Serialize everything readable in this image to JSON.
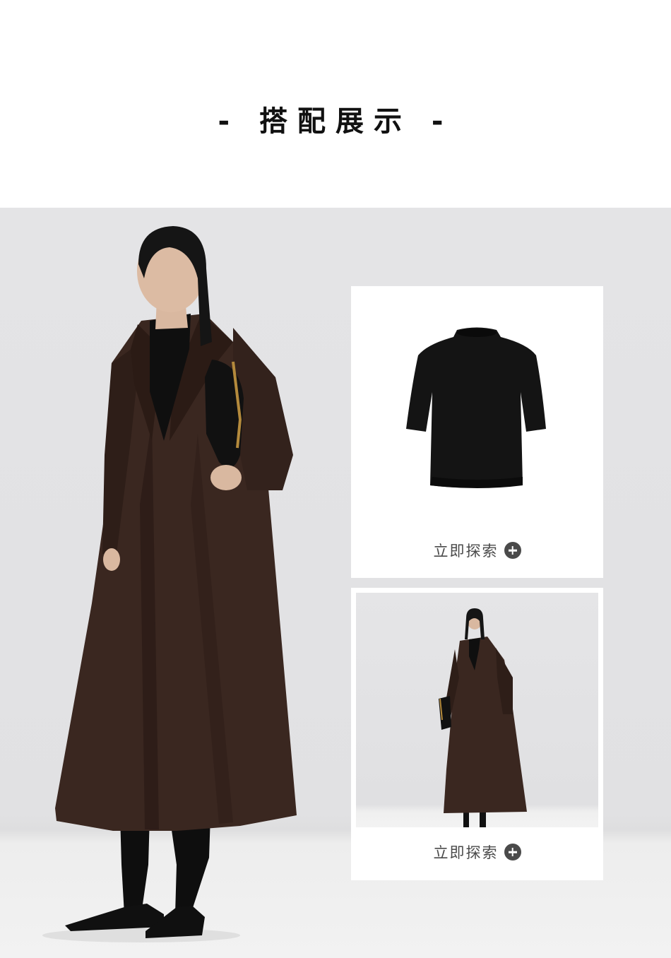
{
  "header": {
    "title": "- 搭配展示 -"
  },
  "main_photo": {
    "alt_icon": "model-photo-icon"
  },
  "products": [
    {
      "name_icon": "black-knit-top-icon",
      "explore_label": "立即探索",
      "plus_icon": "plus-circle-icon"
    },
    {
      "name_icon": "model-photo-icon",
      "explore_label": "立即探索",
      "plus_icon": "plus-circle-icon"
    }
  ],
  "colors": {
    "coat": "#3a2720",
    "black": "#111111",
    "background": "#e3e3e5",
    "button": "#4a4a4a"
  }
}
